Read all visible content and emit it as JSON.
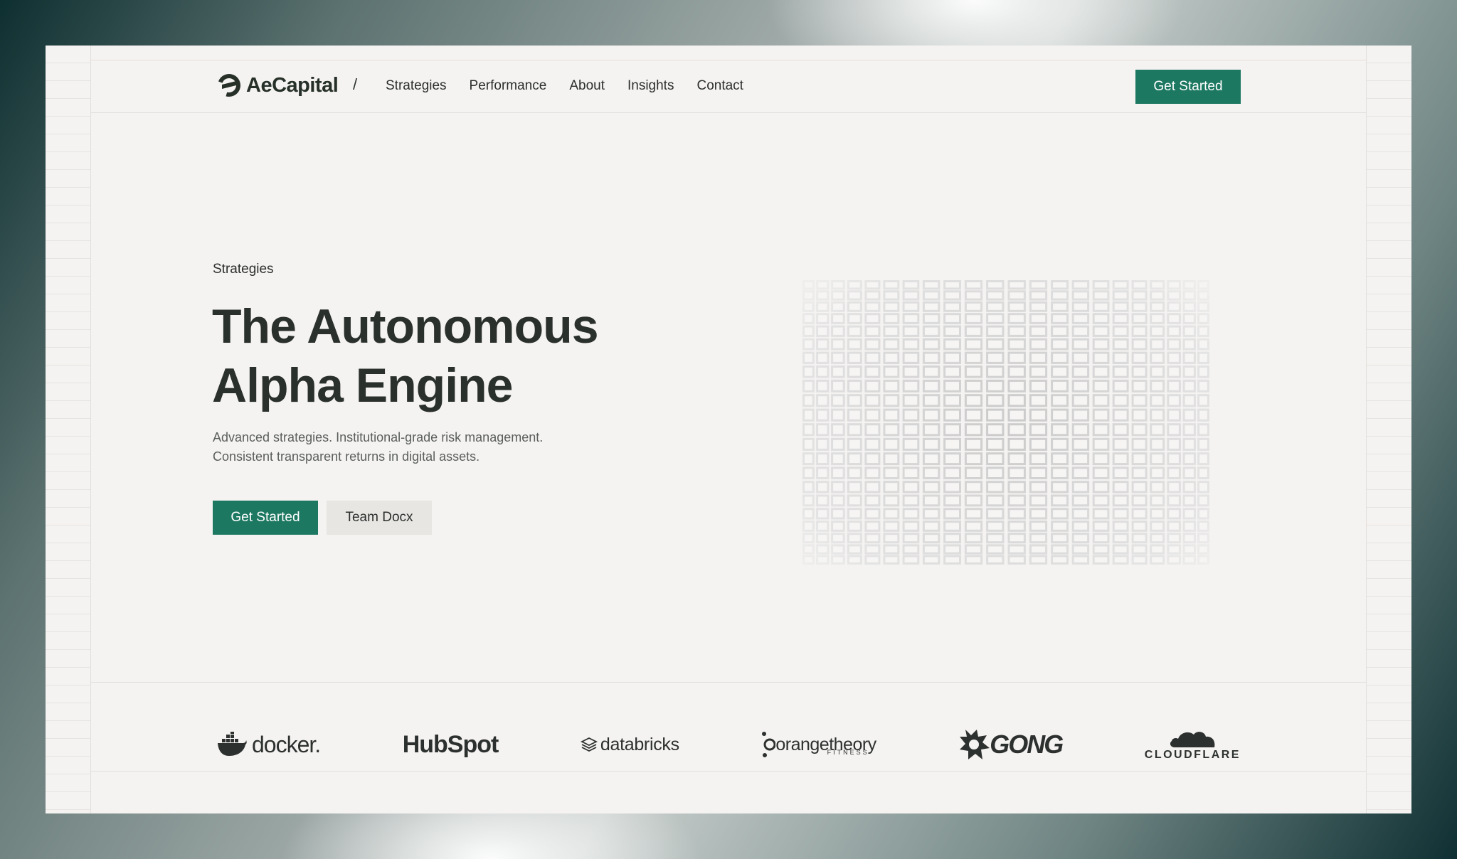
{
  "brand": {
    "name": "AeCapital",
    "separator": "/"
  },
  "nav": {
    "items": [
      "Strategies",
      "Performance",
      "About",
      "Insights",
      "Contact"
    ]
  },
  "header": {
    "cta_label": "Get Started"
  },
  "hero": {
    "eyebrow": "Strategies",
    "title_line1": "The Autonomous",
    "title_line2": "Alpha Engine",
    "subtitle_line1": "Advanced strategies. Institutional-grade risk management.",
    "subtitle_line2": "Consistent transparent returns in digital assets.",
    "primary_label": "Get Started",
    "secondary_label": "Team Docx"
  },
  "logos": {
    "docker": "docker.",
    "hubspot": "HubSpot",
    "databricks": "databricks",
    "orangetheory": "orangetheory",
    "orangetheory_sub": "FITNESS",
    "gong": "GONG",
    "cloudflare": "CLOUDFLARE"
  },
  "colors": {
    "accent": "#1d7862",
    "text_dark": "#2a302c",
    "background": "#f5f3f1",
    "secondary_button": "#e8e6e3"
  }
}
